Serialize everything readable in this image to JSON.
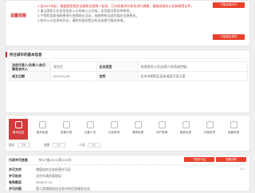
{
  "notice": {
    "side_label": "温馨提醒",
    "lines": [
      "1.自2021年起，根据国家相关法规和全国统一标准，已对检查评价体系进行调整，请查阅相关公告和政策文件。",
      "2.请以国家企业信用信息公示系统公示为准，本页面内容仅供参考。",
      "3.不得利用查询结果进行违规商业活动，违者将依法追究相应法律责任。",
      "4.如对公示信息有异议，请联系相关登记机关或拨打服务热线。"
    ],
    "top_button": "下载年报PDF",
    "bottom_button": "下载报告附件"
  },
  "company": {
    "section_title": "所在城市的基本信息",
    "rows": [
      {
        "k1": "法定代表人/负责人/执行事务合伙人",
        "v1": "张先生",
        "k2": "企业类型",
        "v2": "有限责任公司(自然人投资或控股)"
      },
      {
        "k1": "成立日期",
        "v1": "2019-01-05",
        "k2": "住所",
        "v2": "北京市朝阳区某街道某号某大厦"
      }
    ]
  },
  "tabs": {
    "items": [
      "基本信息",
      "股东信息",
      "变更记录",
      "主要人员",
      "分支机构",
      "清算信息",
      "动产抵押",
      "股权出质",
      "行政处罚",
      "经营异常"
    ],
    "counts": [
      {
        "label": "股东",
        "value": "29"
      },
      {
        "label": "变更",
        "value": "17"
      },
      {
        "label": "人员",
        "value": "12"
      }
    ]
  },
  "record": {
    "title_label": "行政许可信息",
    "title_value": "京ICP备2023-第2023号",
    "btn_a": "下载许可证",
    "btn_b": "查看详情",
    "pager": "1/1 ›",
    "rows": [
      {
        "k": "许可文件",
        "v": "增值电信业务经营许可证"
      },
      {
        "k": "许可机关",
        "v": "北京市通信管理局"
      },
      {
        "k": "有效期至",
        "v": "2025-07-21"
      },
      {
        "k": "许可内容",
        "v": "第二类增值电信业务中的信息服务业务"
      }
    ]
  }
}
